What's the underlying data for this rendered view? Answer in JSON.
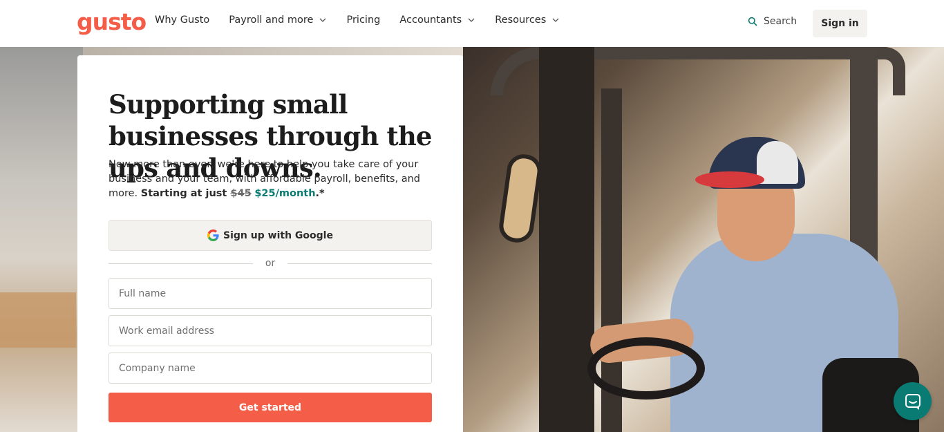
{
  "brand": {
    "logo_text": "gusto",
    "accent_color": "#f45d48",
    "teal_color": "#0a7b73"
  },
  "header": {
    "nav": [
      {
        "label": "Why Gusto",
        "has_dropdown": false
      },
      {
        "label": "Payroll and more",
        "has_dropdown": true
      },
      {
        "label": "Pricing",
        "has_dropdown": false
      },
      {
        "label": "Accountants",
        "has_dropdown": true
      },
      {
        "label": "Resources",
        "has_dropdown": true
      }
    ],
    "search_label": "Search",
    "signin_label": "Sign in"
  },
  "hero": {
    "headline": "Supporting small businesses through the ups and downs.",
    "subcopy_intro": "Now more than ever, we're here to help you take care of your business and your team, with affordable payroll, benefits, and more. ",
    "subcopy_starting": "Starting at just ",
    "price_old": "$45",
    "price_new": "$25/month",
    "subcopy_end": ".*"
  },
  "signup": {
    "google_label": "Sign up with Google",
    "divider_label": "or",
    "full_name_placeholder": "Full name",
    "email_placeholder": "Work email address",
    "company_placeholder": "Company name",
    "full_name_value": "",
    "email_value": "",
    "company_value": "",
    "cta_label": "Get started"
  },
  "icons": {
    "search": "search-icon",
    "chevron": "chevron-down-icon",
    "google": "google-icon",
    "chat": "chat-icon"
  }
}
